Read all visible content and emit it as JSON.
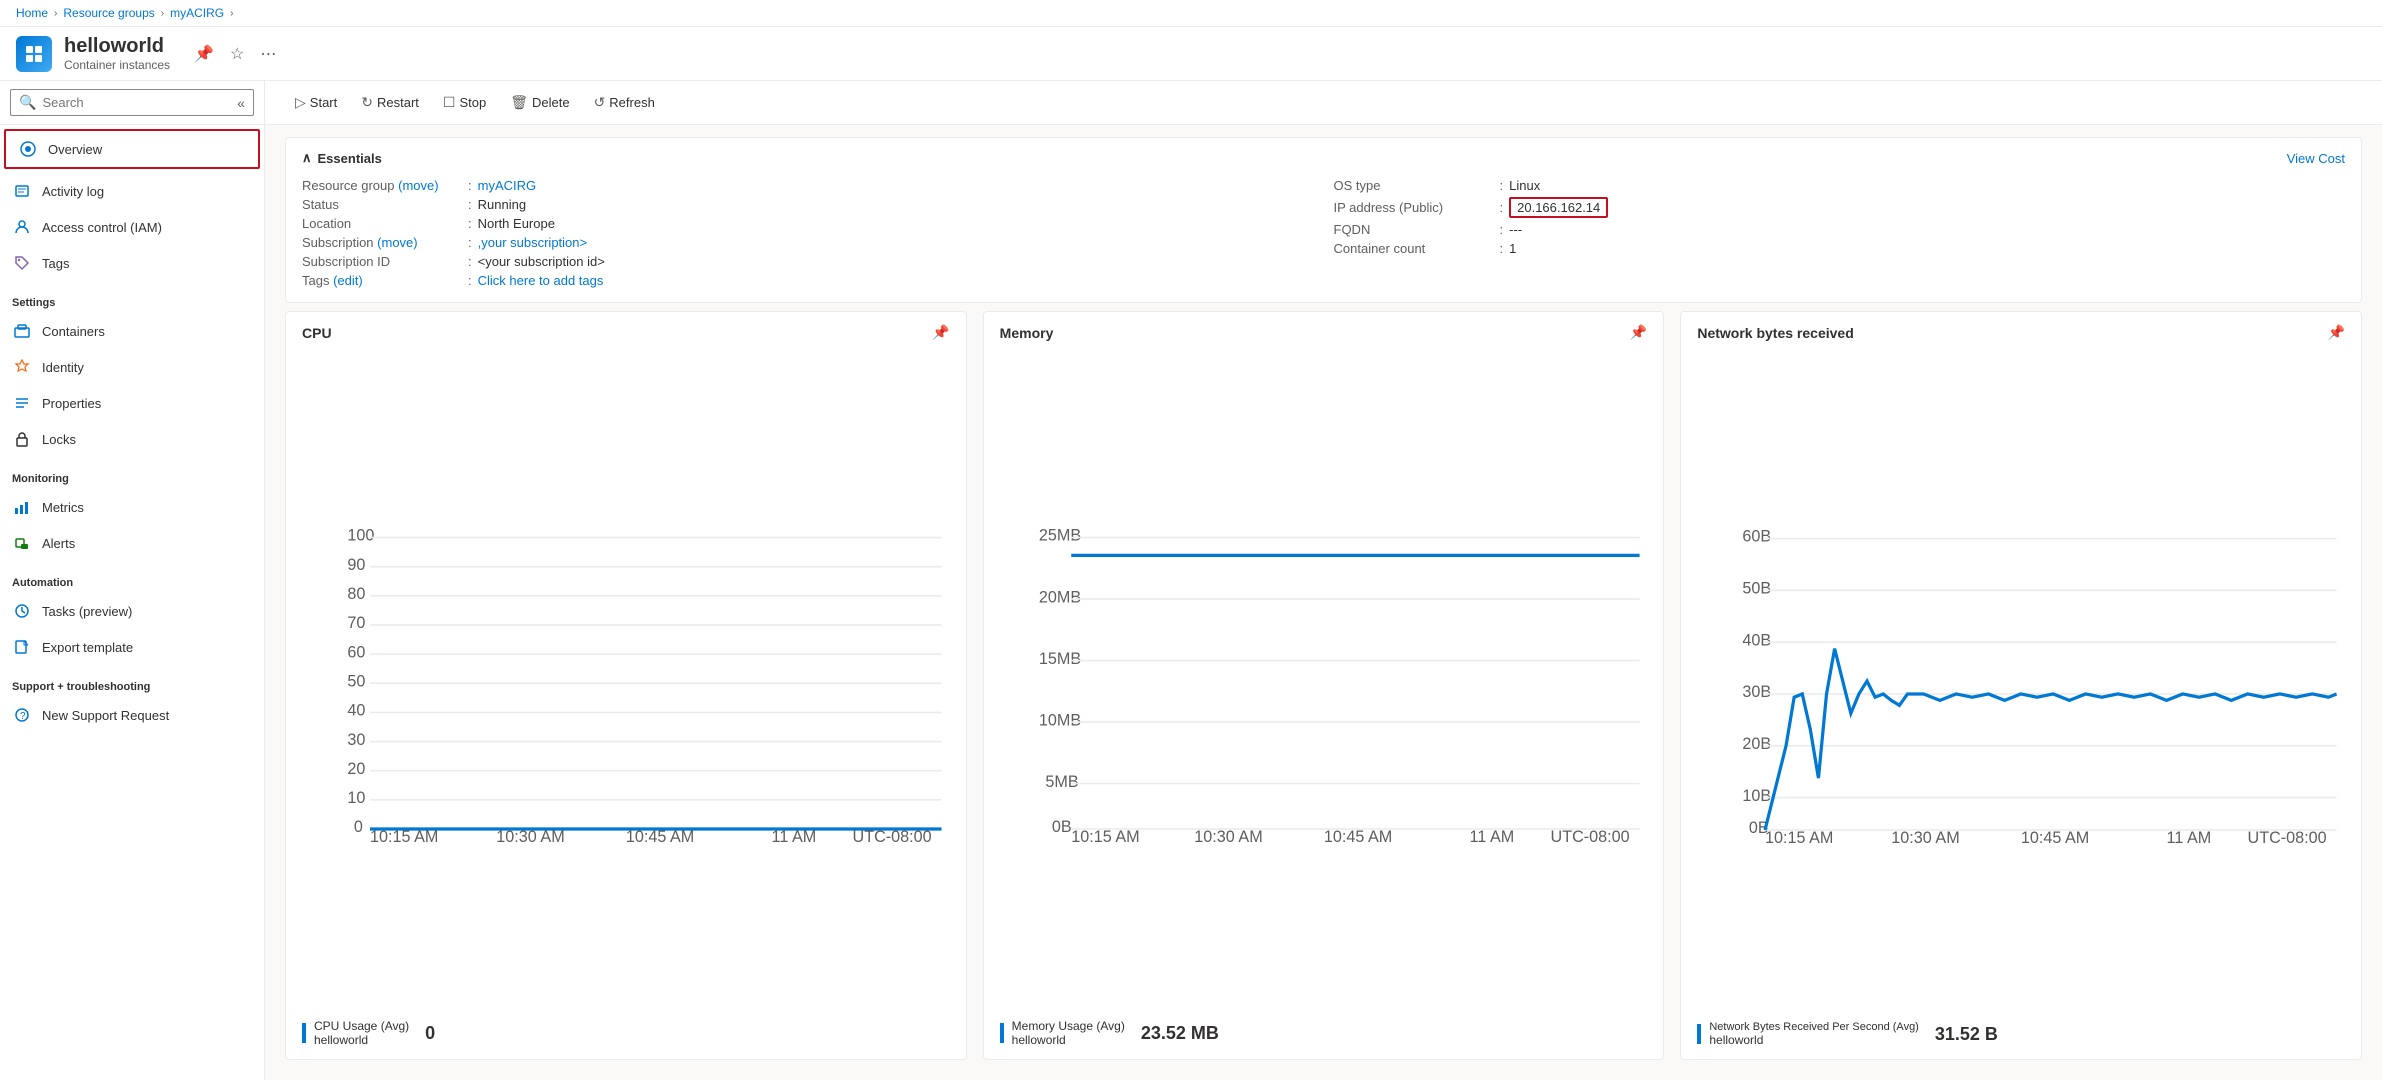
{
  "breadcrumb": {
    "home": "Home",
    "resource_groups": "Resource groups",
    "myacirg": "myACIRG",
    "sep": "›"
  },
  "app": {
    "title": "helloworld",
    "subtitle": "Container instances"
  },
  "toolbar": {
    "start_label": "Start",
    "restart_label": "Restart",
    "stop_label": "Stop",
    "delete_label": "Delete",
    "refresh_label": "Refresh"
  },
  "sidebar": {
    "search_placeholder": "Search",
    "items": [
      {
        "id": "overview",
        "label": "Overview",
        "icon": "🌐",
        "active": true
      },
      {
        "id": "activity-log",
        "label": "Activity log",
        "icon": "📋"
      },
      {
        "id": "access-control",
        "label": "Access control (IAM)",
        "icon": "👤"
      },
      {
        "id": "tags",
        "label": "Tags",
        "icon": "🏷"
      }
    ],
    "settings_label": "Settings",
    "settings_items": [
      {
        "id": "containers",
        "label": "Containers",
        "icon": "📦"
      },
      {
        "id": "identity",
        "label": "Identity",
        "icon": "✨"
      },
      {
        "id": "properties",
        "label": "Properties",
        "icon": "📊"
      },
      {
        "id": "locks",
        "label": "Locks",
        "icon": "🔒"
      }
    ],
    "monitoring_label": "Monitoring",
    "monitoring_items": [
      {
        "id": "metrics",
        "label": "Metrics",
        "icon": "📈"
      },
      {
        "id": "alerts",
        "label": "Alerts",
        "icon": "🔔"
      }
    ],
    "automation_label": "Automation",
    "automation_items": [
      {
        "id": "tasks",
        "label": "Tasks (preview)",
        "icon": "⚙"
      },
      {
        "id": "export-template",
        "label": "Export template",
        "icon": "📤"
      }
    ],
    "support_label": "Support + troubleshooting",
    "support_items": [
      {
        "id": "new-support",
        "label": "New Support Request",
        "icon": "❓"
      }
    ]
  },
  "essentials": {
    "title": "Essentials",
    "view_cost": "View Cost",
    "fields_left": [
      {
        "label": "Resource group (move)",
        "value": "myACIRG",
        "link": true
      },
      {
        "label": "Status",
        "value": "Running",
        "link": false
      },
      {
        "label": "Location",
        "value": "North Europe",
        "link": false
      },
      {
        "label": "Subscription (move)",
        "value": ",your subscription>",
        "link": true
      },
      {
        "label": "Subscription ID",
        "value": "<your subscription id>",
        "link": false
      },
      {
        "label": "Tags (edit)",
        "value": "Click here to add tags",
        "link": true
      }
    ],
    "fields_right": [
      {
        "label": "OS type",
        "value": "Linux",
        "link": false
      },
      {
        "label": "IP address (Public)",
        "value": "20.166.162.14",
        "link": false,
        "highlight": true
      },
      {
        "label": "FQDN",
        "value": "---",
        "link": false
      },
      {
        "label": "Container count",
        "value": "1",
        "link": false
      }
    ]
  },
  "charts": {
    "cpu": {
      "title": "CPU",
      "legend_label": "CPU Usage (Avg)",
      "legend_sub": "helloworld",
      "value": "0",
      "y_labels": [
        "100",
        "90",
        "80",
        "70",
        "60",
        "50",
        "40",
        "30",
        "20",
        "10",
        "0"
      ],
      "x_labels": [
        "10:15 AM",
        "10:30 AM",
        "10:45 AM",
        "11 AM",
        "UTC-08:00"
      ]
    },
    "memory": {
      "title": "Memory",
      "legend_label": "Memory Usage (Avg)",
      "legend_sub": "helloworld",
      "value": "23.52 MB",
      "y_labels": [
        "25MB",
        "20MB",
        "15MB",
        "10MB",
        "5MB",
        "0B"
      ],
      "x_labels": [
        "10:15 AM",
        "10:30 AM",
        "10:45 AM",
        "11 AM",
        "UTC-08:00"
      ]
    },
    "network": {
      "title": "Network bytes received",
      "legend_label": "Network Bytes Received Per Second (Avg)",
      "legend_sub": "helloworld",
      "value": "31.52 B",
      "y_labels": [
        "60B",
        "50B",
        "40B",
        "30B",
        "20B",
        "10B",
        "0B"
      ],
      "x_labels": [
        "10:15 AM",
        "10:30 AM",
        "10:45 AM",
        "11 AM",
        "UTC-08:00"
      ]
    }
  }
}
